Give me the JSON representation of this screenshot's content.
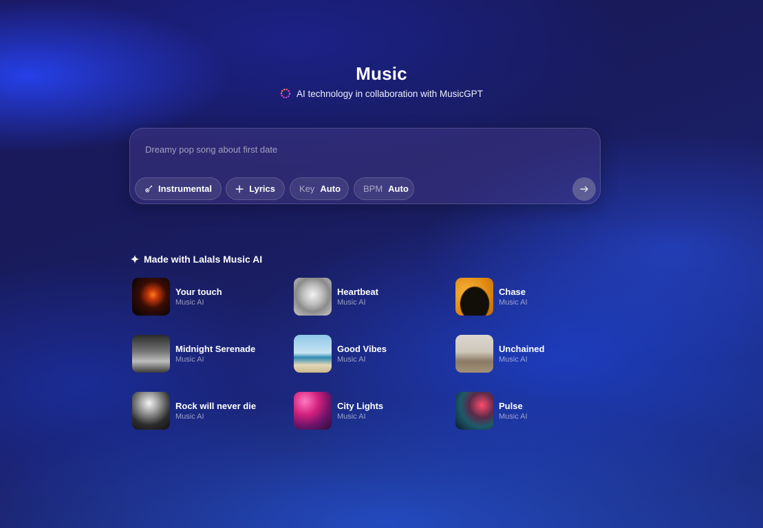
{
  "header": {
    "title": "Music",
    "subtitle": "AI technology in collaboration with MusicGPT",
    "subtitle_icon": "ring-logo-icon"
  },
  "prompt": {
    "placeholder": "Dreamy pop song about first date",
    "value": "",
    "chips": {
      "instrumental": {
        "label": "Instrumental",
        "icon": "guitar-icon"
      },
      "lyrics": {
        "label": "Lyrics",
        "icon": "plus-icon"
      },
      "key": {
        "label": "Key",
        "value": "Auto"
      },
      "bpm": {
        "label": "BPM",
        "value": "Auto"
      }
    },
    "send_icon": "arrow-right-icon"
  },
  "showcase": {
    "title": "Made with Lalals Music AI",
    "title_icon": "sparkle-icon",
    "tracks": [
      {
        "name": "Your touch",
        "subtitle": "Music AI"
      },
      {
        "name": "Heartbeat",
        "subtitle": "Music AI"
      },
      {
        "name": "Chase",
        "subtitle": "Music AI"
      },
      {
        "name": "Midnight Serenade",
        "subtitle": "Music AI"
      },
      {
        "name": "Good Vibes",
        "subtitle": "Music AI"
      },
      {
        "name": "Unchained",
        "subtitle": "Music AI"
      },
      {
        "name": "Rock will never die",
        "subtitle": "Music AI"
      },
      {
        "name": "City Lights",
        "subtitle": "Music AI"
      },
      {
        "name": "Pulse",
        "subtitle": "Music AI"
      }
    ]
  }
}
